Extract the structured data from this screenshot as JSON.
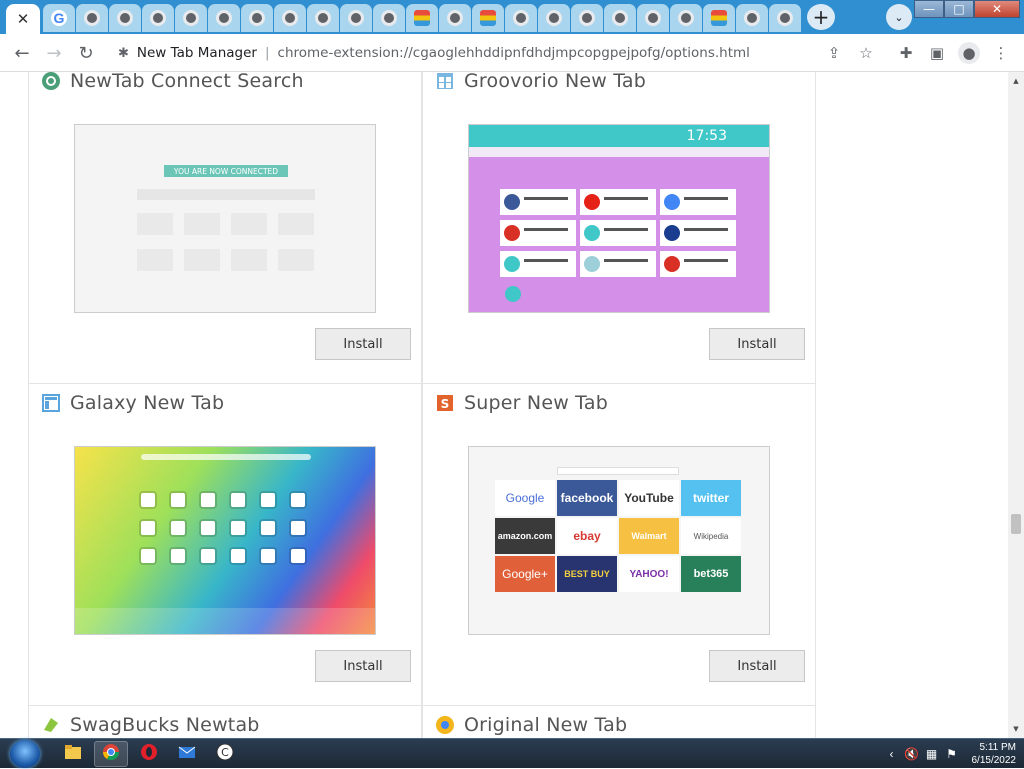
{
  "browser": {
    "active_tab_close": "✕",
    "new_tab_symbol": "+",
    "tab_search_symbol": "⌄",
    "omnibox": {
      "origin": "New Tab Manager",
      "separator": "|",
      "url": "chrome-extension://cgaoglehhddipnfdhdjmpcopgpejpofg/options.html"
    },
    "window_controls": {
      "minimize": "—",
      "maximize": "□",
      "close": "✕"
    }
  },
  "page": {
    "cards": [
      {
        "title": "NewTab Connect Search",
        "install_label": "Install",
        "shot_text": "YOU ARE NOW CONNECTED"
      },
      {
        "title": "Groovorio New Tab",
        "install_label": "Install",
        "shot_text": "17:53"
      },
      {
        "title": "Galaxy New Tab",
        "install_label": "Install"
      },
      {
        "title": "Super New Tab",
        "install_label": "Install",
        "tiles": [
          "Google",
          "facebook",
          "YouTube",
          "twitter",
          "amazon.com",
          "ebay",
          "Walmart",
          "Wikipedia",
          "Google+",
          "BEST BUY",
          "YAHOO!",
          "bet365"
        ]
      },
      {
        "title": "SwagBucks Newtab"
      },
      {
        "title": "Original New Tab"
      }
    ]
  },
  "taskbar": {
    "time": "5:11 PM",
    "date": "6/15/2022"
  },
  "colors": {
    "tabstrip": "#2f8fd0",
    "groovorio_bg": "#d48fe8",
    "teal": "#40c7c8"
  }
}
